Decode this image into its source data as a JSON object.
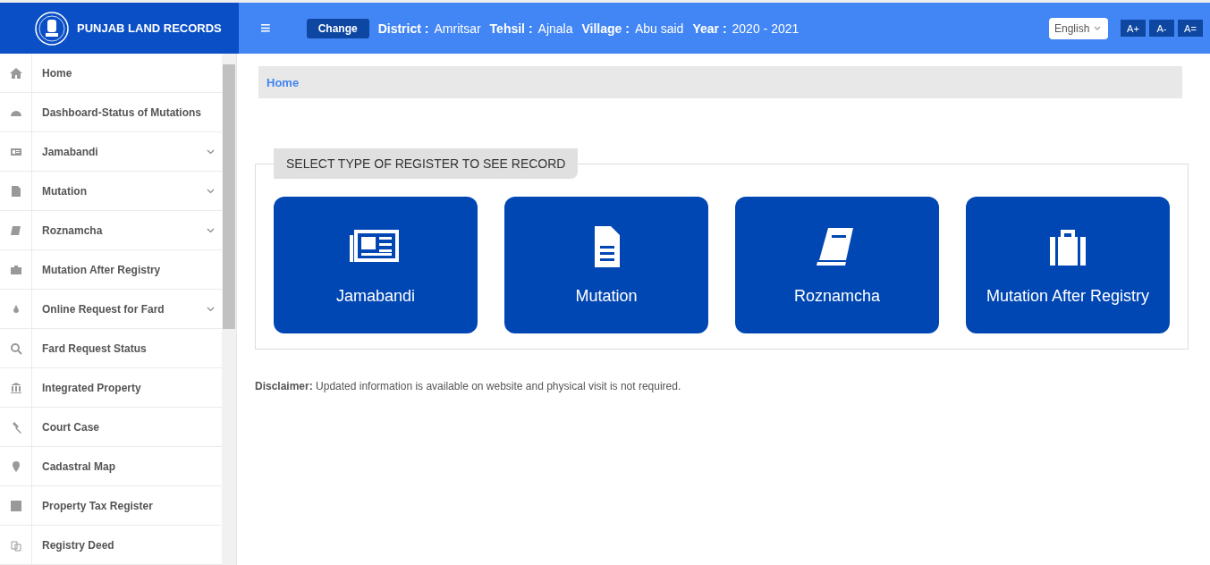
{
  "header": {
    "title": "PUNJAB LAND RECORDS",
    "menu_glyph": "≡",
    "change_button": "Change",
    "fields": [
      {
        "label": "District :",
        "value": "Amritsar"
      },
      {
        "label": "Tehsil :",
        "value": "Ajnala"
      },
      {
        "label": "Village :",
        "value": "Abu said"
      },
      {
        "label": "Year :",
        "value": "2020 - 2021"
      }
    ],
    "language": "English",
    "font_buttons": [
      "A+",
      "A-",
      "A="
    ]
  },
  "sidebar": {
    "items": [
      {
        "label": "Home",
        "has_submenu": false
      },
      {
        "label": "Dashboard-Status of Mutations",
        "has_submenu": false
      },
      {
        "label": "Jamabandi",
        "has_submenu": true
      },
      {
        "label": "Mutation",
        "has_submenu": true
      },
      {
        "label": "Roznamcha",
        "has_submenu": true
      },
      {
        "label": "Mutation After Registry",
        "has_submenu": false
      },
      {
        "label": "Online Request for Fard",
        "has_submenu": true
      },
      {
        "label": "Fard Request Status",
        "has_submenu": false
      },
      {
        "label": "Integrated Property",
        "has_submenu": false
      },
      {
        "label": "Court Case",
        "has_submenu": false
      },
      {
        "label": "Cadastral Map",
        "has_submenu": false
      },
      {
        "label": "Property Tax Register",
        "has_submenu": false
      },
      {
        "label": "Registry Deed",
        "has_submenu": false
      }
    ]
  },
  "breadcrumb": "Home",
  "register_panel": {
    "legend": "SELECT TYPE OF REGISTER TO SEE RECORD",
    "tiles": [
      {
        "label": "Jamabandi"
      },
      {
        "label": "Mutation"
      },
      {
        "label": "Roznamcha"
      },
      {
        "label": "Mutation After Registry"
      }
    ]
  },
  "disclaimer": "**Disclaimer:** Updated information is available on website and physical visit is not required."
}
